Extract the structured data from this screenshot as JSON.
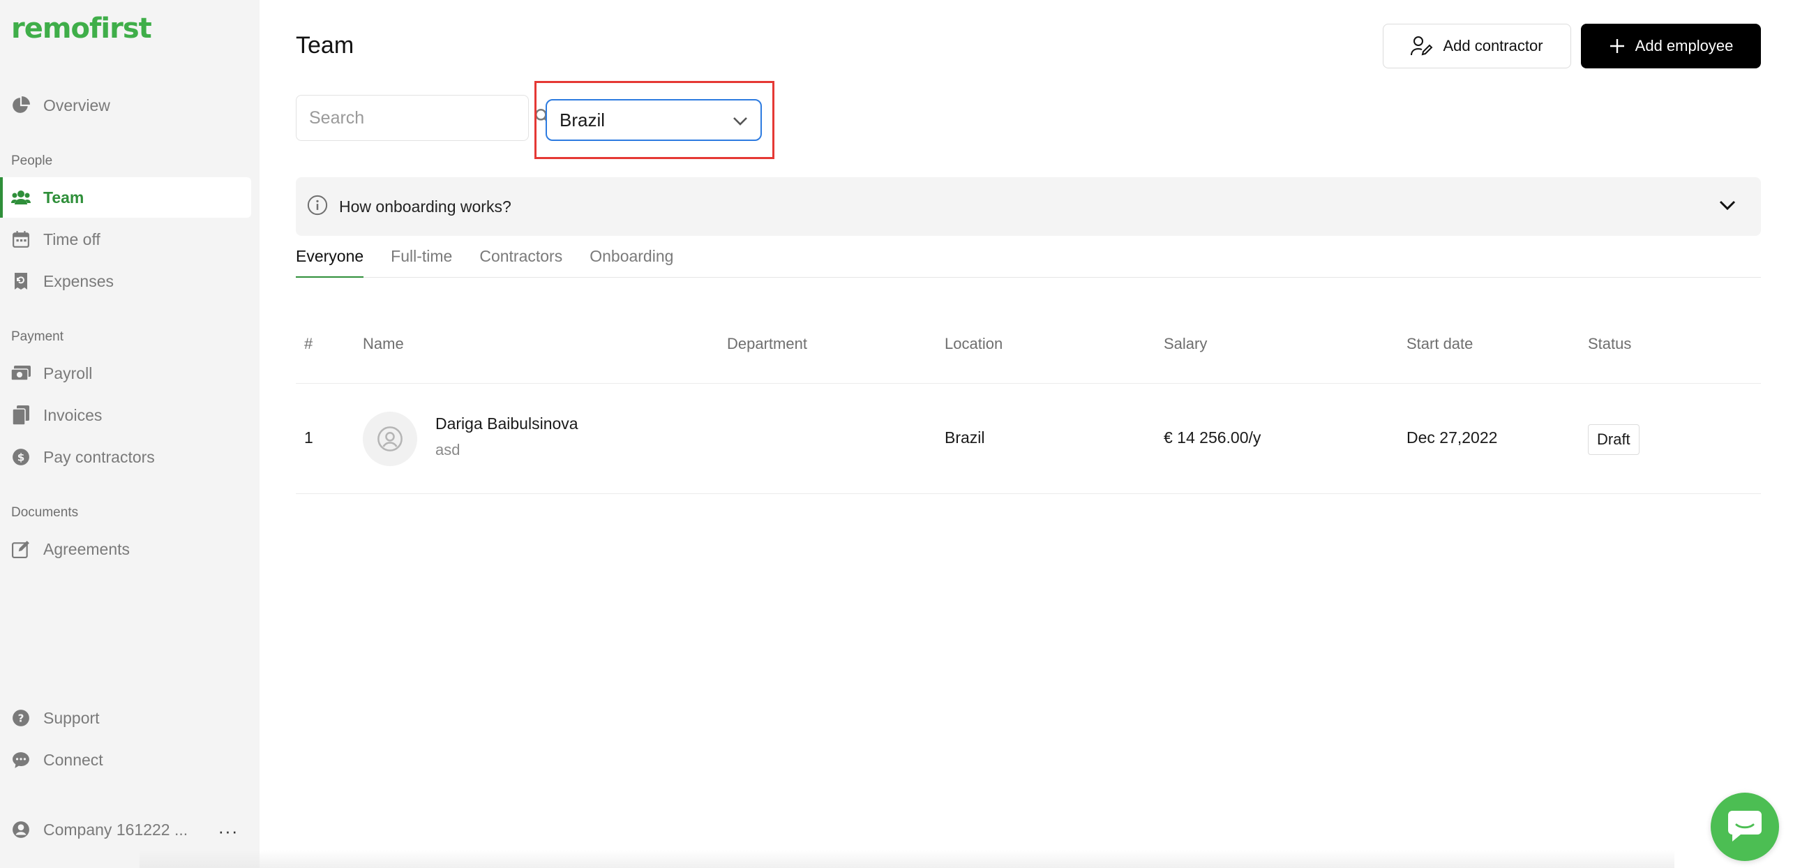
{
  "brand": {
    "logo_text": "remofirst",
    "color": "#3fae49"
  },
  "sidebar": {
    "overview": "Overview",
    "sections": {
      "people": "People",
      "payment": "Payment",
      "documents": "Documents"
    },
    "items": {
      "team": "Team",
      "time_off": "Time off",
      "expenses": "Expenses",
      "payroll": "Payroll",
      "invoices": "Invoices",
      "pay_contractors": "Pay contractors",
      "agreements": "Agreements",
      "support": "Support",
      "connect": "Connect"
    },
    "company": "Company 161222 ...",
    "more": "···"
  },
  "header": {
    "title": "Team",
    "add_contractor": "Add contractor",
    "add_employee": "Add employee"
  },
  "filters": {
    "search_placeholder": "Search",
    "country_selected": "Brazil"
  },
  "info": {
    "label": "How onboarding works?"
  },
  "tabs": [
    "Everyone",
    "Full-time",
    "Contractors",
    "Onboarding"
  ],
  "table": {
    "columns": [
      "#",
      "Name",
      "Department",
      "Location",
      "Salary",
      "Start date",
      "Status"
    ],
    "rows": [
      {
        "index": "1",
        "name": "Dariga Baibulsinova",
        "subtitle": "asd",
        "department": "",
        "location": "Brazil",
        "salary": "€ 14 256.00/y",
        "start_date": "Dec 27,2022",
        "status": "Draft"
      }
    ]
  },
  "colors": {
    "accent": "#2f8f3a",
    "select_border": "#2d7be0",
    "highlight": "#e53935",
    "chat": "#4cbe53"
  }
}
